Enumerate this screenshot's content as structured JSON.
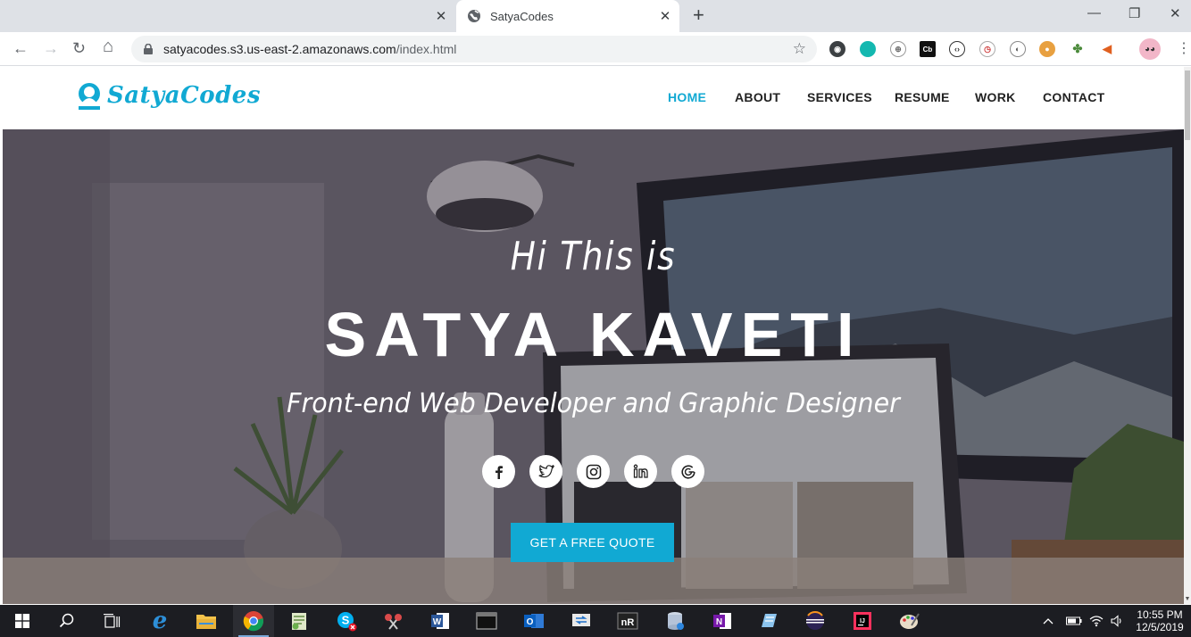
{
  "browser": {
    "tabs": [
      {
        "title": "",
        "close_label": "✕"
      },
      {
        "title": "SatyaCodes",
        "close_label": "✕"
      }
    ],
    "new_tab_label": "+",
    "window_controls": {
      "minimize": "—",
      "maximize": "❐",
      "close": "✕"
    },
    "url": {
      "host": "satyacodes.s3.us-east-2.amazonaws.com",
      "path": "/index.html"
    },
    "nav_buttons": {
      "back": "←",
      "forward": "→",
      "reload": "↻",
      "home": "⌂"
    },
    "star": "☆",
    "menu": "⋮"
  },
  "site": {
    "logo_text": "SatyaCodes",
    "nav": [
      {
        "label": "HOME",
        "active": true
      },
      {
        "label": "ABOUT",
        "active": false
      },
      {
        "label": "SERVICES",
        "active": false
      },
      {
        "label": "RESUME",
        "active": false
      },
      {
        "label": "WORK",
        "active": false
      },
      {
        "label": "CONTACT",
        "active": false
      }
    ],
    "hero": {
      "greeting": "Hi This is",
      "name": "SATYA KAVETI",
      "tagline": "Front-end Web Developer and Graphic Designer",
      "socials": [
        "facebook-icon",
        "twitter-icon",
        "instagram-icon",
        "linkedin-icon",
        "google-icon"
      ],
      "cta_label": "GET A FREE QUOTE"
    },
    "accent_color": "#11a9d3"
  },
  "taskbar": {
    "time": "10:55 PM",
    "date": "12/5/2019"
  }
}
